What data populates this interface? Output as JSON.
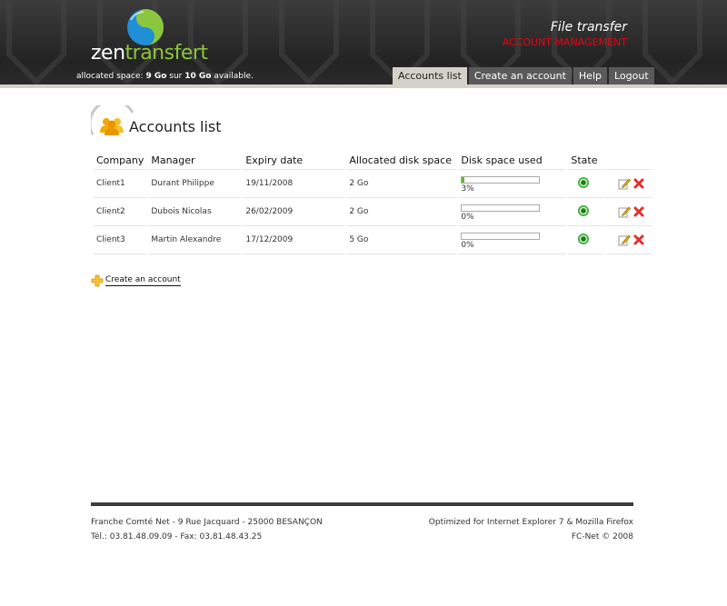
{
  "header": {
    "logo": {
      "part1": "zen",
      "part2": "transfert"
    },
    "allocated": {
      "label": "allocated space:",
      "used": "9 Go",
      "separator": "sur",
      "total": "10 Go",
      "suffix": "available."
    },
    "app_title": "File transfer",
    "app_subtitle": "ACCOUNT MANAGEMENT",
    "nav": [
      {
        "label": "Accounts list",
        "active": true
      },
      {
        "label": "Create an account",
        "active": false
      },
      {
        "label": "Help",
        "active": false
      },
      {
        "label": "Logout",
        "active": false
      }
    ]
  },
  "main": {
    "title": "Accounts list",
    "title_icon": "users-icon",
    "columns": [
      "Company",
      "Manager",
      "Expiry date",
      "Allocated disk space",
      "Disk space used",
      "State"
    ],
    "rows": [
      {
        "company": "Client1",
        "manager": "Durant Philippe",
        "expiry": "19/11/2008",
        "allocated": "2 Go",
        "used_pct": 3,
        "used_label": "3%",
        "state": "active"
      },
      {
        "company": "Client2",
        "manager": "Dubois Nicolas",
        "expiry": "26/02/2009",
        "allocated": "2 Go",
        "used_pct": 0,
        "used_label": "0%",
        "state": "active"
      },
      {
        "company": "Client3",
        "manager": "Martin Alexandre",
        "expiry": "17/12/2009",
        "allocated": "5 Go",
        "used_pct": 0,
        "used_label": "0%",
        "state": "active"
      }
    ],
    "row_icons": {
      "state": "status-active-icon",
      "edit": "edit-icon",
      "delete": "delete-icon"
    },
    "create_link": "Create an account"
  },
  "footer": {
    "address": "Franche Comté Net - 9 Rue Jacquard - 25000 BESANÇON",
    "phone": "Tél.: 03.81.48.09.09 - Fax: 03.81.48.43.25",
    "optimized": "Optimized for Internet Explorer 7 & Mozilla Firefox",
    "copyright": "FC-Net © 2008"
  },
  "colors": {
    "accent_green": "#5cbd2b",
    "accent_red": "#e30613",
    "header_dark": "#2c2c2c",
    "tab_active": "#d4d2c8"
  }
}
